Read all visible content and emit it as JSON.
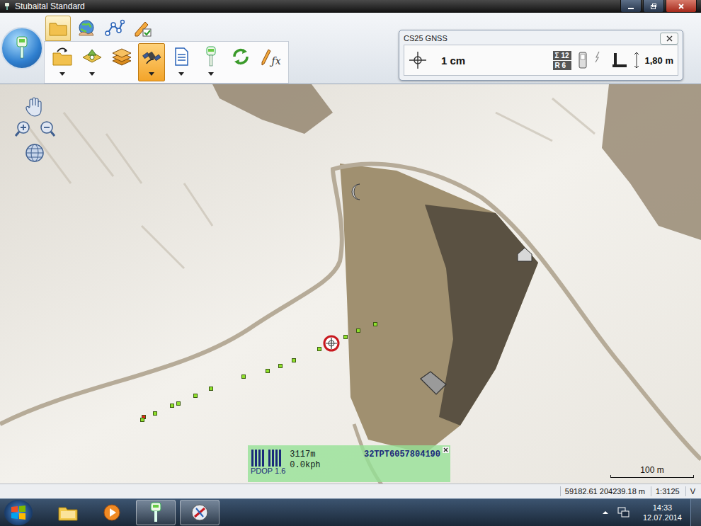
{
  "window": {
    "title": "Stubaital Standard"
  },
  "ribbon": {
    "tabs": [
      {
        "kind": "file",
        "selected": true
      },
      {
        "kind": "map",
        "selected": false
      },
      {
        "kind": "edit-lines",
        "selected": false
      },
      {
        "kind": "edit-check",
        "selected": false
      }
    ],
    "tools": [
      {
        "kind": "open",
        "selected": false,
        "dropdown": true
      },
      {
        "kind": "add-point",
        "selected": false,
        "dropdown": true
      },
      {
        "kind": "layers",
        "selected": false,
        "dropdown": false
      },
      {
        "kind": "gps",
        "selected": true,
        "dropdown": true
      },
      {
        "kind": "document",
        "selected": false,
        "dropdown": true
      },
      {
        "kind": "receiver",
        "selected": false,
        "dropdown": true
      },
      {
        "kind": "refresh",
        "selected": false,
        "dropdown": false
      },
      {
        "kind": "formula",
        "selected": false,
        "dropdown": false,
        "label": "ƒx"
      }
    ]
  },
  "gnss_panel": {
    "title": "CS25 GNSS",
    "precision": "1 cm",
    "satellites": "Σ 12",
    "reference": "R 6",
    "antenna_height": "1,80 m"
  },
  "map": {
    "track_points": [
      {
        "color": "#e8231c"
      },
      {
        "color": "#8fe02c"
      },
      {
        "color": "#8fe02c"
      },
      {
        "color": "#8fe02c"
      },
      {
        "color": "#8fe02c"
      },
      {
        "color": "#8fe02c"
      },
      {
        "color": "#8fe02c"
      },
      {
        "color": "#8fe02c"
      },
      {
        "color": "#8fe02c"
      },
      {
        "color": "#8fe02c"
      },
      {
        "color": "#8fe02c"
      },
      {
        "color": "#8fe02c"
      },
      {
        "color": "#8fe02c"
      },
      {
        "color": "#8fe02c"
      },
      {
        "color": "#8fe02c"
      }
    ],
    "status": {
      "altitude": "3117m",
      "speed": "0.0kph",
      "pdop": "PDOP 1.6",
      "position": "32TPT6057804190"
    },
    "scale": "100 m"
  },
  "status_bar": {
    "coordinates": "59182.61 204239.18 m",
    "scale": "1:3125",
    "mode": "V"
  },
  "taskbar": {
    "apps": [
      {
        "kind": "explorer",
        "open": false
      },
      {
        "kind": "media",
        "open": false
      },
      {
        "kind": "gnss",
        "open": true
      },
      {
        "kind": "map",
        "open": true
      }
    ],
    "time": "14:33",
    "date": "12.07.2014"
  }
}
